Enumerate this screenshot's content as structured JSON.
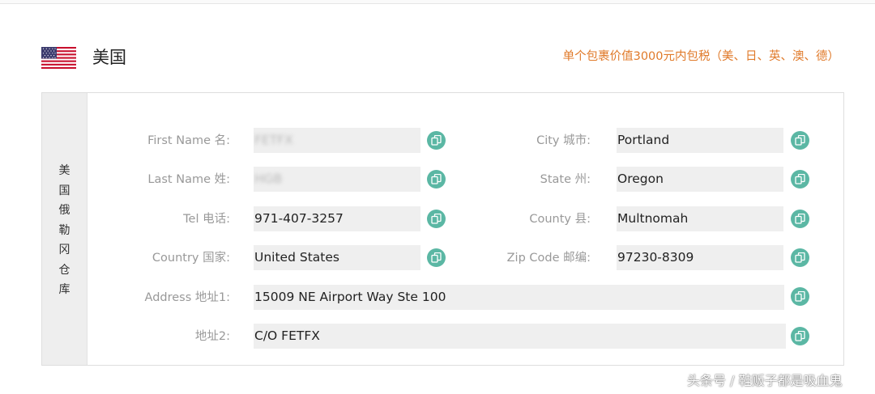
{
  "header": {
    "flag_icon": "us-flag-icon",
    "country": "美国",
    "tax_note": "单个包裹价值3000元内包税（美、日、英、澳、德）"
  },
  "warehouse": {
    "label": "美国俄勒冈仓库"
  },
  "fields": {
    "first_name": {
      "label": "First Name 名:",
      "value": "FETFX"
    },
    "last_name": {
      "label": "Last Name 姓:",
      "value": "HGB"
    },
    "tel": {
      "label": "Tel 电话:",
      "value": "971-407-3257"
    },
    "country": {
      "label": "Country 国家:",
      "value": "United States"
    },
    "address1": {
      "label": "Address 地址1:",
      "value": "15009 NE Airport Way Ste 100"
    },
    "address2": {
      "label": "地址2:",
      "value": "C/O FETFX"
    },
    "city": {
      "label": "City 城市:",
      "value": "Portland"
    },
    "state": {
      "label": "State 州:",
      "value": "Oregon"
    },
    "county": {
      "label": "County 县:",
      "value": "Multnomah"
    },
    "zip": {
      "label": "Zip Code 邮编:",
      "value": "97230-8309"
    }
  },
  "copy_icon": "copy-icon",
  "colors": {
    "accent_orange": "#e07a2a",
    "copy_button": "#5bb7a4",
    "field_bg": "#efefef"
  },
  "watermark": "头条号 / 鞋贩子都是吸血鬼"
}
